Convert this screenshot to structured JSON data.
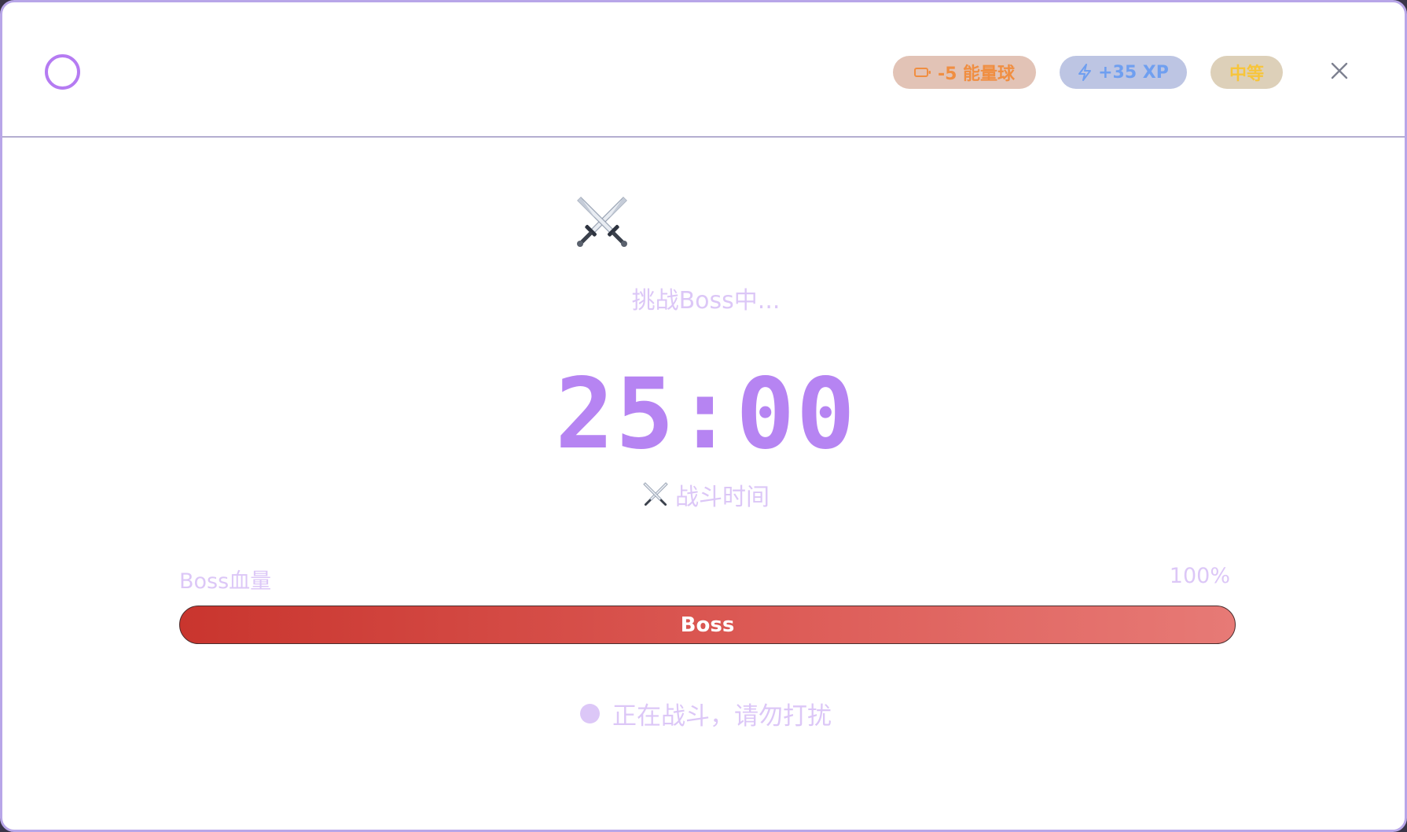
{
  "header": {
    "energy_badge": "-5 能量球",
    "xp_badge": "+35 XP",
    "difficulty_badge": "中等",
    "icons": {
      "status": "circle-outline-icon",
      "energy": "battery-icon",
      "xp": "lightning-bolt-icon",
      "close": "close-icon"
    }
  },
  "battle": {
    "hero_icon": "crossed-swords-icon",
    "status_text": "挑战Boss中...",
    "timer": "25:00",
    "timer_label": "战斗时间"
  },
  "boss_hp": {
    "label": "Boss血量",
    "percent_text": "100%",
    "percent": 100,
    "bar_label": "Boss"
  },
  "footer": {
    "status_text": "正在战斗，请勿打扰"
  },
  "colors": {
    "accent": "#b684f2",
    "muted_text": "#dcc7f7",
    "energy": "#f08e41",
    "xp": "#6f9ff0",
    "difficulty": "#f7c53a",
    "boss_bar_start": "#c9352e",
    "boss_bar_end": "#e77a76"
  }
}
